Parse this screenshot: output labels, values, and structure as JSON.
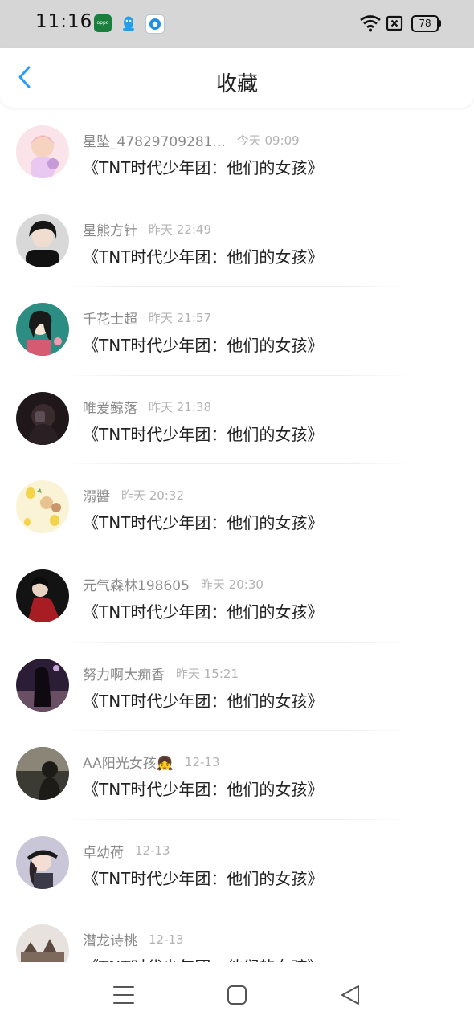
{
  "status_bar": {
    "time": "11:16",
    "battery": "78",
    "apps": [
      "oppo-icon",
      "qq-icon",
      "browser-icon"
    ],
    "signals": [
      "wifi-icon",
      "no-sim-icon",
      "battery-icon"
    ],
    "oppo_label": "oppo"
  },
  "header": {
    "title": "收藏",
    "back_icon": "chevron-left-icon",
    "accent": "#2a9df4"
  },
  "favorites": [
    {
      "name": "星坠_47829709281...",
      "time": "今天 09:09",
      "title": "《TNT时代少年团：他们的女孩》"
    },
    {
      "name": "星熊方针",
      "time": "昨天 22:49",
      "title": "《TNT时代少年团：他们的女孩》"
    },
    {
      "name": "千花士超",
      "time": "昨天 21:57",
      "title": "《TNT时代少年团：他们的女孩》"
    },
    {
      "name": "唯爱鲸落",
      "time": "昨天 21:38",
      "title": "《TNT时代少年团：他们的女孩》"
    },
    {
      "name": "溺醬",
      "time": "昨天 20:32",
      "title": "《TNT时代少年团：他们的女孩》"
    },
    {
      "name": "元气森林198605",
      "time": "昨天 20:30",
      "title": "《TNT时代少年团：他们的女孩》"
    },
    {
      "name": "努力啊大痴香",
      "time": "昨天 15:21",
      "title": "《TNT时代少年团：他们的女孩》"
    },
    {
      "name": "AA阳光女孩👧",
      "time": "12-13",
      "title": "《TNT时代少年团：他们的女孩》"
    },
    {
      "name": "卓幼荷",
      "time": "12-13",
      "title": "《TNT时代少年团：他们的女孩》"
    },
    {
      "name": "潜龙诗桃",
      "time": "12-13",
      "title": "《TNT时代少年团：他们的女孩》"
    }
  ],
  "nav_bar": {
    "buttons": [
      "menu-icon",
      "home-square-icon",
      "back-triangle-icon"
    ]
  }
}
